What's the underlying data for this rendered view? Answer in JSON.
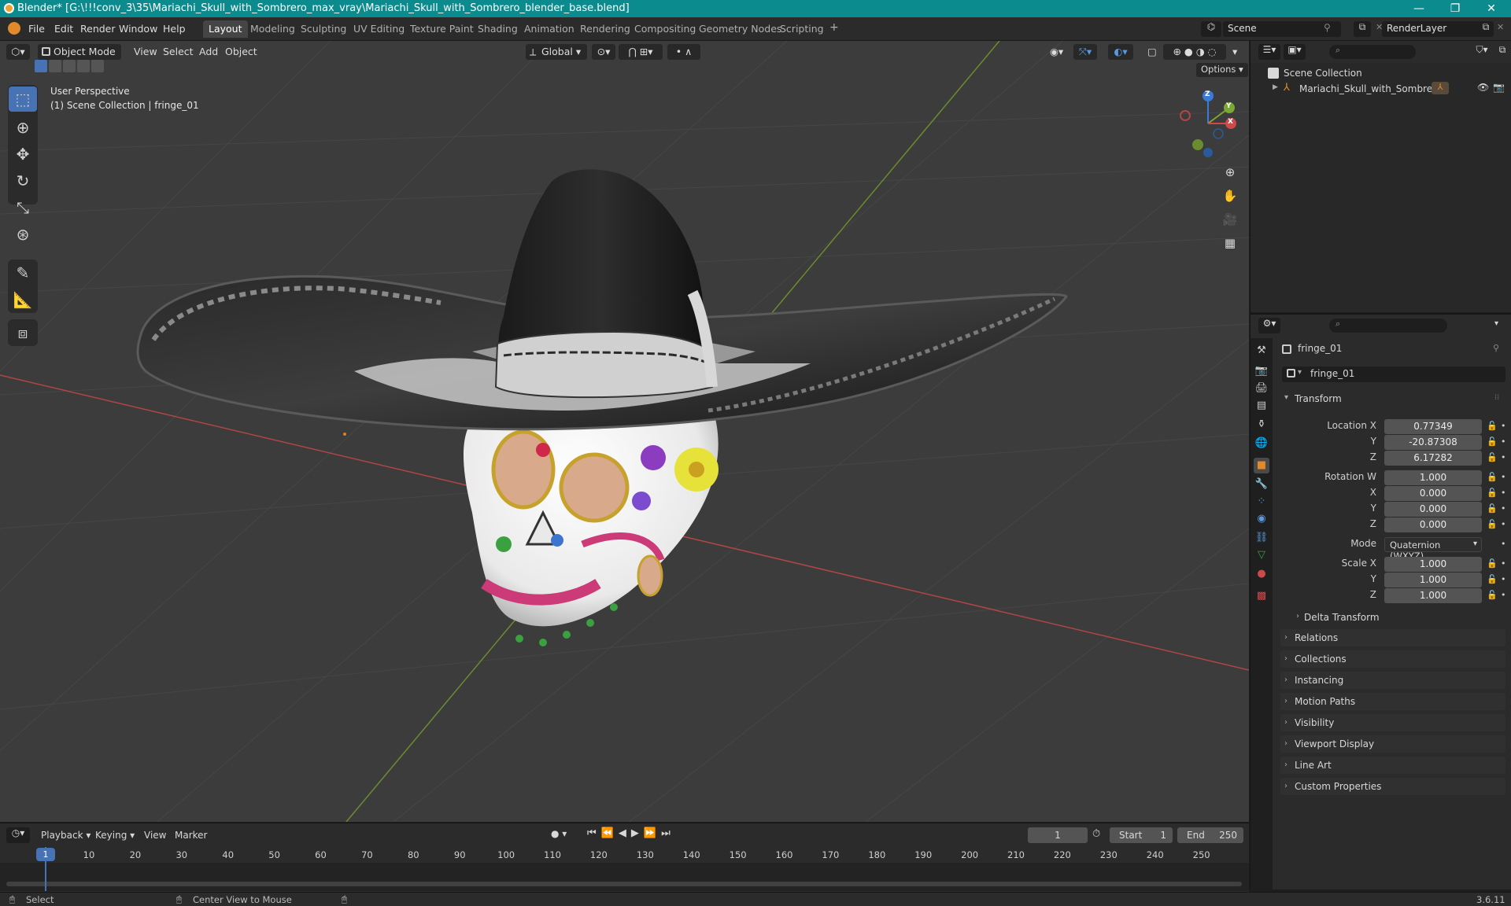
{
  "titlebar": {
    "title": "Blender* [G:\\!!!conv_3\\35\\Mariachi_Skull_with_Sombrero_max_vray\\Mariachi_Skull_with_Sombrero_blender_base.blend]",
    "minimize": "—",
    "maximize": "❐",
    "close": "✕"
  },
  "menu": {
    "file": "File",
    "edit": "Edit",
    "render": "Render",
    "window": "Window",
    "help": "Help"
  },
  "workspaces": {
    "layout": "Layout",
    "modeling": "Modeling",
    "sculpting": "Sculpting",
    "uv": "UV Editing",
    "texture": "Texture Paint",
    "shading": "Shading",
    "animation": "Animation",
    "rendering": "Rendering",
    "compositing": "Compositing",
    "geonodes": "Geometry Nodes",
    "scripting": "Scripting",
    "add": "+"
  },
  "scene": {
    "name": "Scene",
    "renderlayer": "RenderLayer"
  },
  "viewport": {
    "mode": "Object Mode",
    "view": "View",
    "select": "Select",
    "add": "Add",
    "object": "Object",
    "orientation": "Global",
    "options": "Options",
    "overlay_line1": "User Perspective",
    "overlay_line2": "(1) Scene Collection | fringe_01",
    "gizmo": {
      "z": "Z",
      "y": "Y",
      "x": "X"
    }
  },
  "outliner": {
    "root": "Scene Collection",
    "item": "Mariachi_Skull_with_Sombrero"
  },
  "properties": {
    "object_name": "fringe_01",
    "data_name": "fringe_01",
    "transform_header": "Transform",
    "location_label": "Location X",
    "loc": {
      "x": "0.77349",
      "y": "-20.87308",
      "z": "6.17282"
    },
    "rotation_label": "Rotation W",
    "rot": {
      "w": "1.000",
      "x": "0.000",
      "y": "0.000",
      "z": "0.000"
    },
    "mode_label": "Mode",
    "mode_value": "Quaternion (WXYZ)",
    "scale_label": "Scale X",
    "scale": {
      "x": "1.000",
      "y": "1.000",
      "z": "1.000"
    },
    "axis": {
      "x": "X",
      "y": "Y",
      "z": "Z"
    },
    "delta": "Delta Transform",
    "sections": [
      "Relations",
      "Collections",
      "Instancing",
      "Motion Paths",
      "Visibility",
      "Viewport Display",
      "Line Art",
      "Custom Properties"
    ]
  },
  "timeline": {
    "playback": "Playback",
    "keying": "Keying",
    "view": "View",
    "marker": "Marker",
    "current_frame": "1",
    "start_label": "Start",
    "start": "1",
    "end_label": "End",
    "end": "250",
    "ticks": [
      "1",
      "10",
      "20",
      "30",
      "40",
      "50",
      "60",
      "70",
      "80",
      "90",
      "100",
      "110",
      "120",
      "130",
      "140",
      "150",
      "160",
      "170",
      "180",
      "190",
      "200",
      "210",
      "220",
      "230",
      "240",
      "250"
    ]
  },
  "status": {
    "select": "Select",
    "center": "Center View to Mouse",
    "version": "3.6.11"
  },
  "colors": {
    "accent": "#4772b3",
    "titlebar": "#0c8b8e",
    "x_axis": "#c03c3c",
    "y_axis": "#7ba832"
  }
}
